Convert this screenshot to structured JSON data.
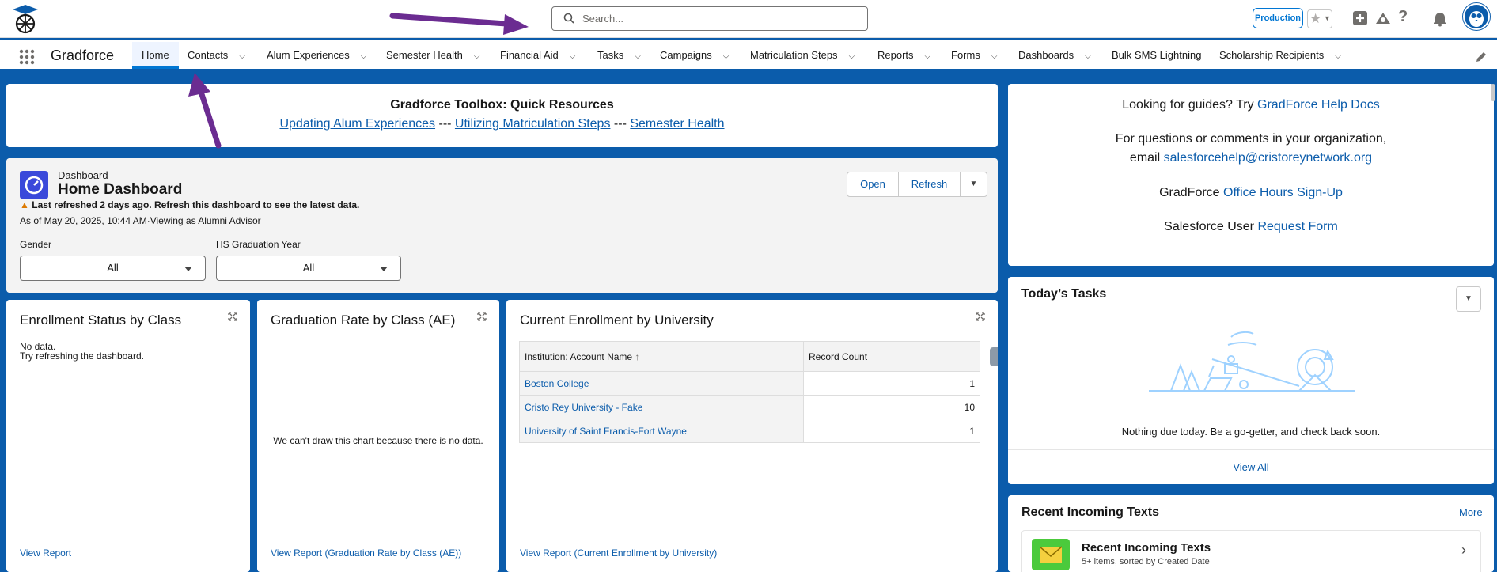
{
  "header": {
    "search_placeholder": "Search...",
    "env_badge": "Production"
  },
  "nav": {
    "app_name": "Gradforce",
    "tabs": [
      {
        "label": "Home",
        "active": true,
        "dropdown": false
      },
      {
        "label": "Contacts",
        "dropdown": true
      },
      {
        "label": "Alum Experiences",
        "dropdown": true
      },
      {
        "label": "Semester Health",
        "dropdown": true
      },
      {
        "label": "Financial Aid",
        "dropdown": true
      },
      {
        "label": "Tasks",
        "dropdown": true
      },
      {
        "label": "Campaigns",
        "dropdown": true
      },
      {
        "label": "Matriculation Steps",
        "dropdown": true
      },
      {
        "label": "Reports",
        "dropdown": true
      },
      {
        "label": "Forms",
        "dropdown": true
      },
      {
        "label": "Dashboards",
        "dropdown": true
      },
      {
        "label": "Bulk SMS Lightning",
        "dropdown": false
      },
      {
        "label": "Scholarship Recipients",
        "dropdown": true
      }
    ]
  },
  "toolbox": {
    "title": "Gradforce Toolbox: Quick Resources",
    "link1": "Updating Alum Experiences",
    "sep1": "---",
    "link2": "Utilizing Matriculation Steps",
    "sep2": "---",
    "link3": "Semester Health"
  },
  "dashboard": {
    "type_label": "Dashboard",
    "name": "Home Dashboard",
    "warning": "Last refreshed 2 days ago. Refresh this dashboard to see the latest data.",
    "as_of": "As of May 20, 2025, 10:44 AM·Viewing as Alumni Advisor",
    "open_label": "Open",
    "refresh_label": "Refresh",
    "filters": [
      {
        "label": "Gender",
        "value": "All"
      },
      {
        "label": "HS Graduation Year",
        "value": "All"
      }
    ]
  },
  "components": {
    "enrollment": {
      "title": "Enrollment Status by Class",
      "nodata1": "No data.",
      "nodata2": "Try refreshing the dashboard.",
      "footer": "View Report"
    },
    "gradrate": {
      "title": "Graduation Rate by Class (AE)",
      "message": "We can't draw this chart because there is no data.",
      "footer": "View Report (Graduation Rate by Class (AE))"
    },
    "current": {
      "title": "Current Enrollment by University",
      "col1": "Institution: Account Name",
      "col2": "Record Count",
      "rows": [
        {
          "name": "Boston College",
          "count": "1"
        },
        {
          "name": "Cristo Rey University - Fake",
          "count": "10"
        },
        {
          "name": "University of Saint Francis-Fort Wayne",
          "count": "1"
        }
      ],
      "footer": "View Report (Current Enrollment by University)"
    }
  },
  "help": {
    "line1_text": "Looking for guides? Try ",
    "line1_link": "GradForce Help Docs",
    "line2": "For questions or comments in your organization,",
    "line3_text": "email ",
    "line3_link": "salesforcehelp@cristoreynetwork.org",
    "line4_text": "GradForce ",
    "line4_link": "Office Hours Sign-Up",
    "line5_text": "Salesforce User ",
    "line5_link": "Request Form"
  },
  "tasks": {
    "title": "Today’s Tasks",
    "empty": "Nothing due today. Be a go-getter, and check back soon.",
    "view_all": "View All"
  },
  "texts": {
    "title": "Recent Incoming Texts",
    "more": "More",
    "item_title": "Recent Incoming Texts",
    "item_sub": "5+ items, sorted by Created Date"
  },
  "colors": {
    "brand": "#0b5cab",
    "accent": "#0176d3",
    "annotation_arrow": "#6b2c91"
  }
}
